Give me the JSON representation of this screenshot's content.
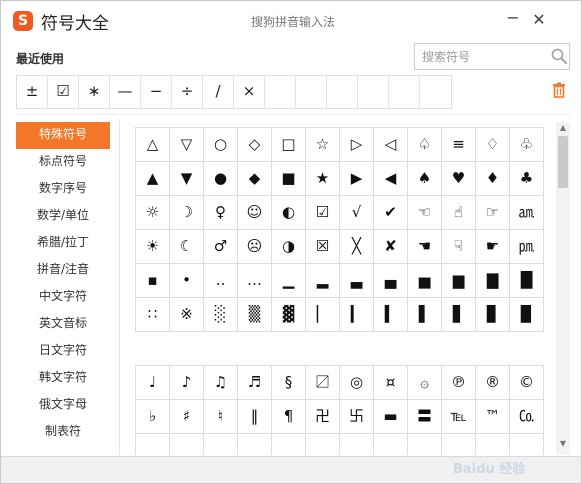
{
  "window": {
    "logo": "S",
    "title": "符号大全",
    "subtitle": "搜狗拼音输入法",
    "minimize": "−",
    "close": "✕"
  },
  "recent": {
    "label": "最近使用",
    "symbols": [
      "±",
      "☑",
      "∗",
      "—",
      "−",
      "÷",
      "/",
      "×",
      "",
      "",
      "",
      "",
      "",
      ""
    ]
  },
  "search": {
    "placeholder": "搜索符号",
    "value": ""
  },
  "sidebar": {
    "items": [
      {
        "label": "特殊符号",
        "active": true
      },
      {
        "label": "标点符号",
        "active": false
      },
      {
        "label": "数字序号",
        "active": false
      },
      {
        "label": "数学/单位",
        "active": false
      },
      {
        "label": "希腊/拉丁",
        "active": false
      },
      {
        "label": "拼音/注音",
        "active": false
      },
      {
        "label": "中文字符",
        "active": false
      },
      {
        "label": "英文音标",
        "active": false
      },
      {
        "label": "日文字符",
        "active": false
      },
      {
        "label": "韩文字符",
        "active": false
      },
      {
        "label": "俄文字母",
        "active": false
      },
      {
        "label": "制表符",
        "active": false
      }
    ]
  },
  "grid1": {
    "rows": [
      [
        "△",
        "▽",
        "○",
        "◇",
        "□",
        "☆",
        "▷",
        "◁",
        "♤",
        "≡",
        "♢",
        "♧"
      ],
      [
        "▲",
        "▼",
        "●",
        "◆",
        "■",
        "★",
        "▶",
        "◀",
        "♠",
        "♥",
        "♦",
        "♣"
      ],
      [
        "☼",
        "☽",
        "♀",
        "☺",
        "◐",
        "☑",
        "√",
        "✔",
        "☜",
        "☝",
        "☞",
        "㏂"
      ],
      [
        "☀",
        "☾",
        "♂",
        "☹",
        "◑",
        "☒",
        "╳",
        "✘",
        "☚",
        "☟",
        "☛",
        "㏘"
      ],
      [
        "▪",
        "•",
        "‥",
        "…",
        "▁",
        "▂",
        "▃",
        "▄",
        "▅",
        "▆",
        "▇",
        "█"
      ],
      [
        "∷",
        "※",
        "░",
        "▒",
        "▓",
        "▏",
        "▎",
        "▍",
        "▌",
        "▋",
        "▊",
        "▉"
      ]
    ]
  },
  "grid2": {
    "rows": [
      [
        "♩",
        "♪",
        "♫",
        "♬",
        "§",
        "〼",
        "◎",
        "¤",
        "۞",
        "℗",
        "®",
        "©"
      ],
      [
        "♭",
        "♯",
        "♮",
        "‖",
        "¶",
        "卍",
        "卐",
        "▬",
        "〓",
        "℡",
        "™",
        "㏇"
      ],
      [
        "",
        "",
        "",
        "",
        "",
        "",
        "",
        "",
        "",
        "",
        "",
        ""
      ]
    ]
  },
  "scrollbar": {
    "up": "▲",
    "down": "▼"
  },
  "watermark": "Baidu 经验",
  "colors": {
    "accent": "#f47628",
    "logo": "#ef5a23",
    "border": "#dcdcdc",
    "bottom_bar": "#f0f0f0"
  }
}
